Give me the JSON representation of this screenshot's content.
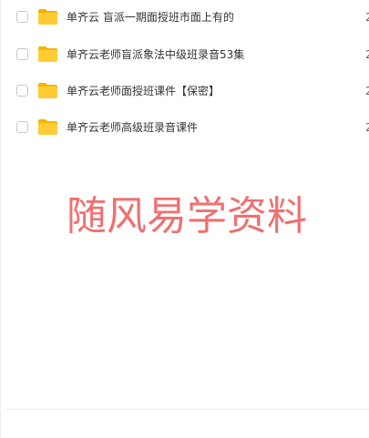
{
  "files": [
    {
      "name": "单齐云 盲派一期面授班市面上有的",
      "meta": "2"
    },
    {
      "name": "单齐云老师盲派象法中级班录音53集",
      "meta": "2"
    },
    {
      "name": "单齐云老师面授班课件【保密】",
      "meta": "2"
    },
    {
      "name": "单齐云老师高级班录音课件",
      "meta": "2"
    }
  ],
  "watermark": "随风易学资料",
  "colors": {
    "folder_body": "#ffcc33",
    "folder_tab": "#f5b400",
    "watermark": "#f07070"
  },
  "icons": {
    "folder": "folder-icon",
    "checkbox": "checkbox"
  }
}
